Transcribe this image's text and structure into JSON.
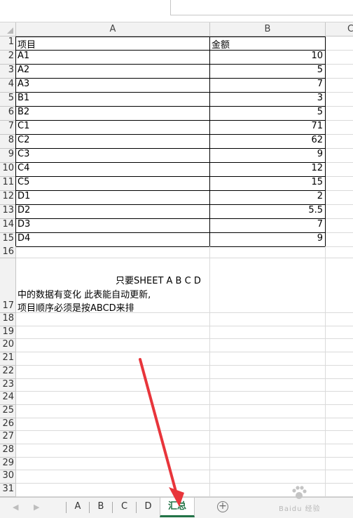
{
  "columns": [
    "A",
    "B",
    "C"
  ],
  "header": {
    "row": "1",
    "a": "项目",
    "b": "金额"
  },
  "rows": [
    {
      "n": "2",
      "a": "A1",
      "b": "10"
    },
    {
      "n": "3",
      "a": "A2",
      "b": "5"
    },
    {
      "n": "4",
      "a": "A3",
      "b": "7"
    },
    {
      "n": "5",
      "a": "B1",
      "b": "3"
    },
    {
      "n": "6",
      "a": "B2",
      "b": "5"
    },
    {
      "n": "7",
      "a": "C1",
      "b": "71"
    },
    {
      "n": "8",
      "a": "C2",
      "b": "62"
    },
    {
      "n": "9",
      "a": "C3",
      "b": "9"
    },
    {
      "n": "10",
      "a": "C4",
      "b": "12"
    },
    {
      "n": "11",
      "a": "C5",
      "b": "15"
    },
    {
      "n": "12",
      "a": "D1",
      "b": "2"
    },
    {
      "n": "13",
      "a": "D2",
      "b": "5.5"
    },
    {
      "n": "14",
      "a": "D3",
      "b": "7"
    },
    {
      "n": "15",
      "a": "D4",
      "b": "9"
    }
  ],
  "row16": "16",
  "note": {
    "row": "17",
    "line1": "只要SHEET A B C D",
    "line2": "中的数据有变化 此表能自动更新,",
    "line3": "项目顺序必须是按ABCD来排"
  },
  "empty_rows": [
    "18",
    "19",
    "20",
    "21",
    "22",
    "23",
    "24",
    "25",
    "26",
    "27",
    "28",
    "29",
    "30",
    "31"
  ],
  "tabs": {
    "nav_prev": "◀",
    "nav_next": "▶",
    "items": [
      "A",
      "B",
      "C",
      "D",
      "汇总"
    ],
    "active": "汇总",
    "add": "+"
  },
  "colors": {
    "accent": "#217346",
    "annotation": "#e8353b",
    "grid": "#dadada"
  },
  "watermark": {
    "text": "Baidu 经验"
  }
}
